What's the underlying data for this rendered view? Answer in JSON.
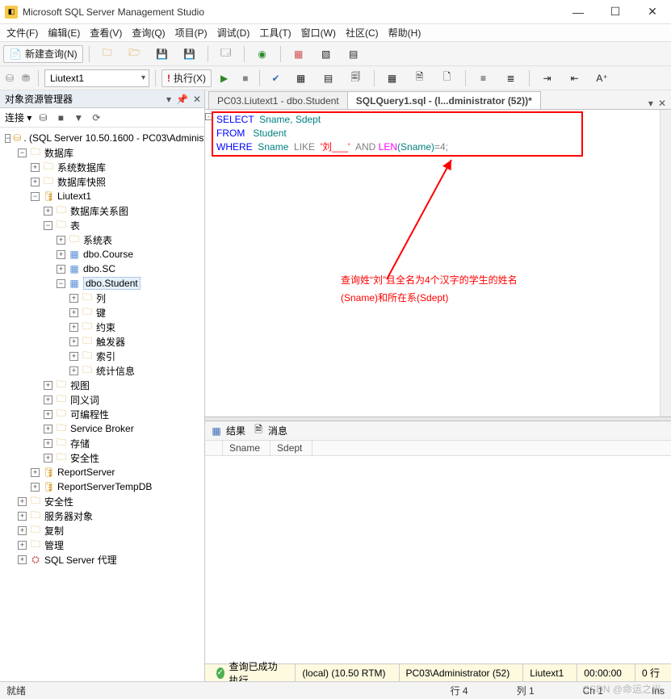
{
  "title": "Microsoft SQL Server Management Studio",
  "menu": [
    "文件(F)",
    "编辑(E)",
    "查看(V)",
    "查询(Q)",
    "项目(P)",
    "调试(D)",
    "工具(T)",
    "窗口(W)",
    "社区(C)",
    "帮助(H)"
  ],
  "toolbar1": {
    "new_query": "新建查询(N)"
  },
  "toolbar2": {
    "db": "Liutext1",
    "execute": "执行(X)",
    "debug": "▶"
  },
  "object_explorer": {
    "title": "对象资源管理器",
    "connect_label": "连接 ▾",
    "root": ". (SQL Server 10.50.1600 - PC03\\Administ",
    "nodes": {
      "databases": "数据库",
      "sysdb": "系统数据库",
      "snapshot": "数据库快照",
      "liutext1": "Liutext1",
      "diagrams": "数据库关系图",
      "tables": "表",
      "systables": "系统表",
      "course": "dbo.Course",
      "sc": "dbo.SC",
      "student": "dbo.Student",
      "columns": "列",
      "keys": "键",
      "constraints": "约束",
      "triggers": "触发器",
      "indexes": "索引",
      "stats": "统计信息",
      "views": "视图",
      "synonyms": "同义词",
      "programmability": "可编程性",
      "servicebroker": "Service Broker",
      "storage": "存储",
      "security_db": "安全性",
      "reportserver": "ReportServer",
      "reportservertemp": "ReportServerTempDB",
      "security": "安全性",
      "serverobjects": "服务器对象",
      "replication": "复制",
      "management": "管理",
      "sqlagent": "SQL Server 代理"
    }
  },
  "tabs": {
    "tab1": "PC03.Liutext1 - dbo.Student",
    "tab2": "SQLQuery1.sql - (l...dministrator (52))*"
  },
  "sql": {
    "l1_select": "SELECT",
    "l1_cols": "  Sname, Sdept",
    "l2_from": "FROM",
    "l2_tbl": "   Student",
    "l3_where": "WHERE",
    "l3_col": "  Sname  ",
    "l3_like": "LIKE",
    "l3_str": "  '刘___'",
    "l3_and": "  AND ",
    "l3_len": "LEN",
    "l3_paren": "(Sname)",
    "l3_eq": "=4;"
  },
  "annotation": {
    "line1": "查询姓“刘”且全名为4个汉字的学生的姓名",
    "line2": "(Sname)和所在系(Sdept)"
  },
  "results": {
    "tab_results": "结果",
    "tab_messages": "消息",
    "col1": "Sname",
    "col2": "Sdept"
  },
  "status": {
    "msg": "查询已成功执行。",
    "server": "(local) (10.50 RTM)",
    "user": "PC03\\Administrator (52)",
    "db": "Liutext1",
    "time": "00:00:00",
    "rows": "0 行"
  },
  "bottom": {
    "ready": "就绪",
    "line": "行 4",
    "col": "列 1",
    "ch": "Ch 1",
    "ins": "Ins"
  },
  "watermark": "CSDN @命运之光"
}
